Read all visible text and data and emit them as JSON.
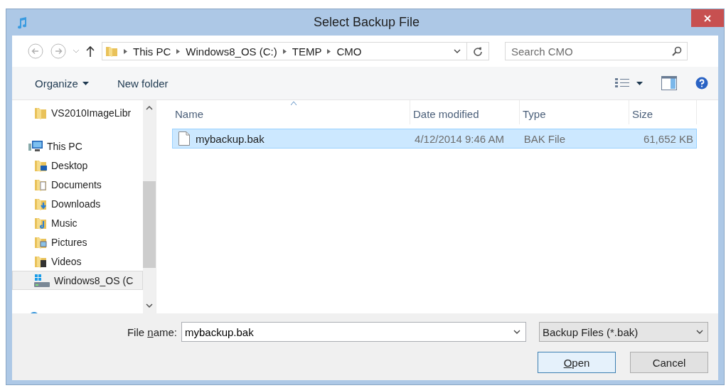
{
  "window": {
    "title": "Select Backup File"
  },
  "address_bar": {
    "crumbs": [
      "This PC",
      "Windows8_OS (C:)",
      "TEMP",
      "CMO"
    ]
  },
  "search": {
    "placeholder": "Search CMO"
  },
  "toolbar": {
    "buttons": [
      {
        "label": "Organize",
        "dropdown": true
      },
      {
        "label": "New folder",
        "dropdown": false
      }
    ]
  },
  "sidebar": {
    "items": [
      {
        "children": [
          {
            "kind": "folder",
            "label": "VS2010ImageLibr",
            "selected": false
          }
        ]
      },
      {
        "kind": "pc",
        "label": "This PC",
        "selected": false,
        "children": [
          {
            "kind": "desktop",
            "label": "Desktop",
            "selected": false
          },
          {
            "kind": "documents",
            "label": "Documents",
            "selected": false
          },
          {
            "kind": "downloads",
            "label": "Downloads",
            "selected": false
          },
          {
            "kind": "music",
            "label": "Music",
            "selected": false
          },
          {
            "kind": "pictures",
            "label": "Pictures",
            "selected": false
          },
          {
            "kind": "videos",
            "label": "Videos",
            "selected": false
          },
          {
            "kind": "drive",
            "label": "Windows8_OS (C",
            "selected": true
          }
        ]
      },
      {
        "kind": "network",
        "selected": false
      }
    ]
  },
  "table": {
    "columns": [
      {
        "label": "Name",
        "sorted": true
      },
      {
        "label": "Date modified",
        "sorted": false
      },
      {
        "label": "Type",
        "sorted": false
      },
      {
        "label": "Size",
        "sorted": false
      }
    ],
    "rows": [
      {
        "name": "mybackup.bak",
        "date_modified": "4/12/2014 9:46 AM",
        "type": "BAK File",
        "size": "61,652 KB",
        "selected": true
      }
    ]
  },
  "footer": {
    "file_name_label": {
      "before": "File ",
      "access_key": "n",
      "after": "ame:"
    },
    "file_name": "mybackup.bak",
    "file_type": "Backup Files (*.bak)",
    "buttons": [
      {
        "access_key": "O",
        "rest": "pen",
        "default": true
      },
      {
        "label": "Cancel",
        "default": false
      }
    ]
  }
}
